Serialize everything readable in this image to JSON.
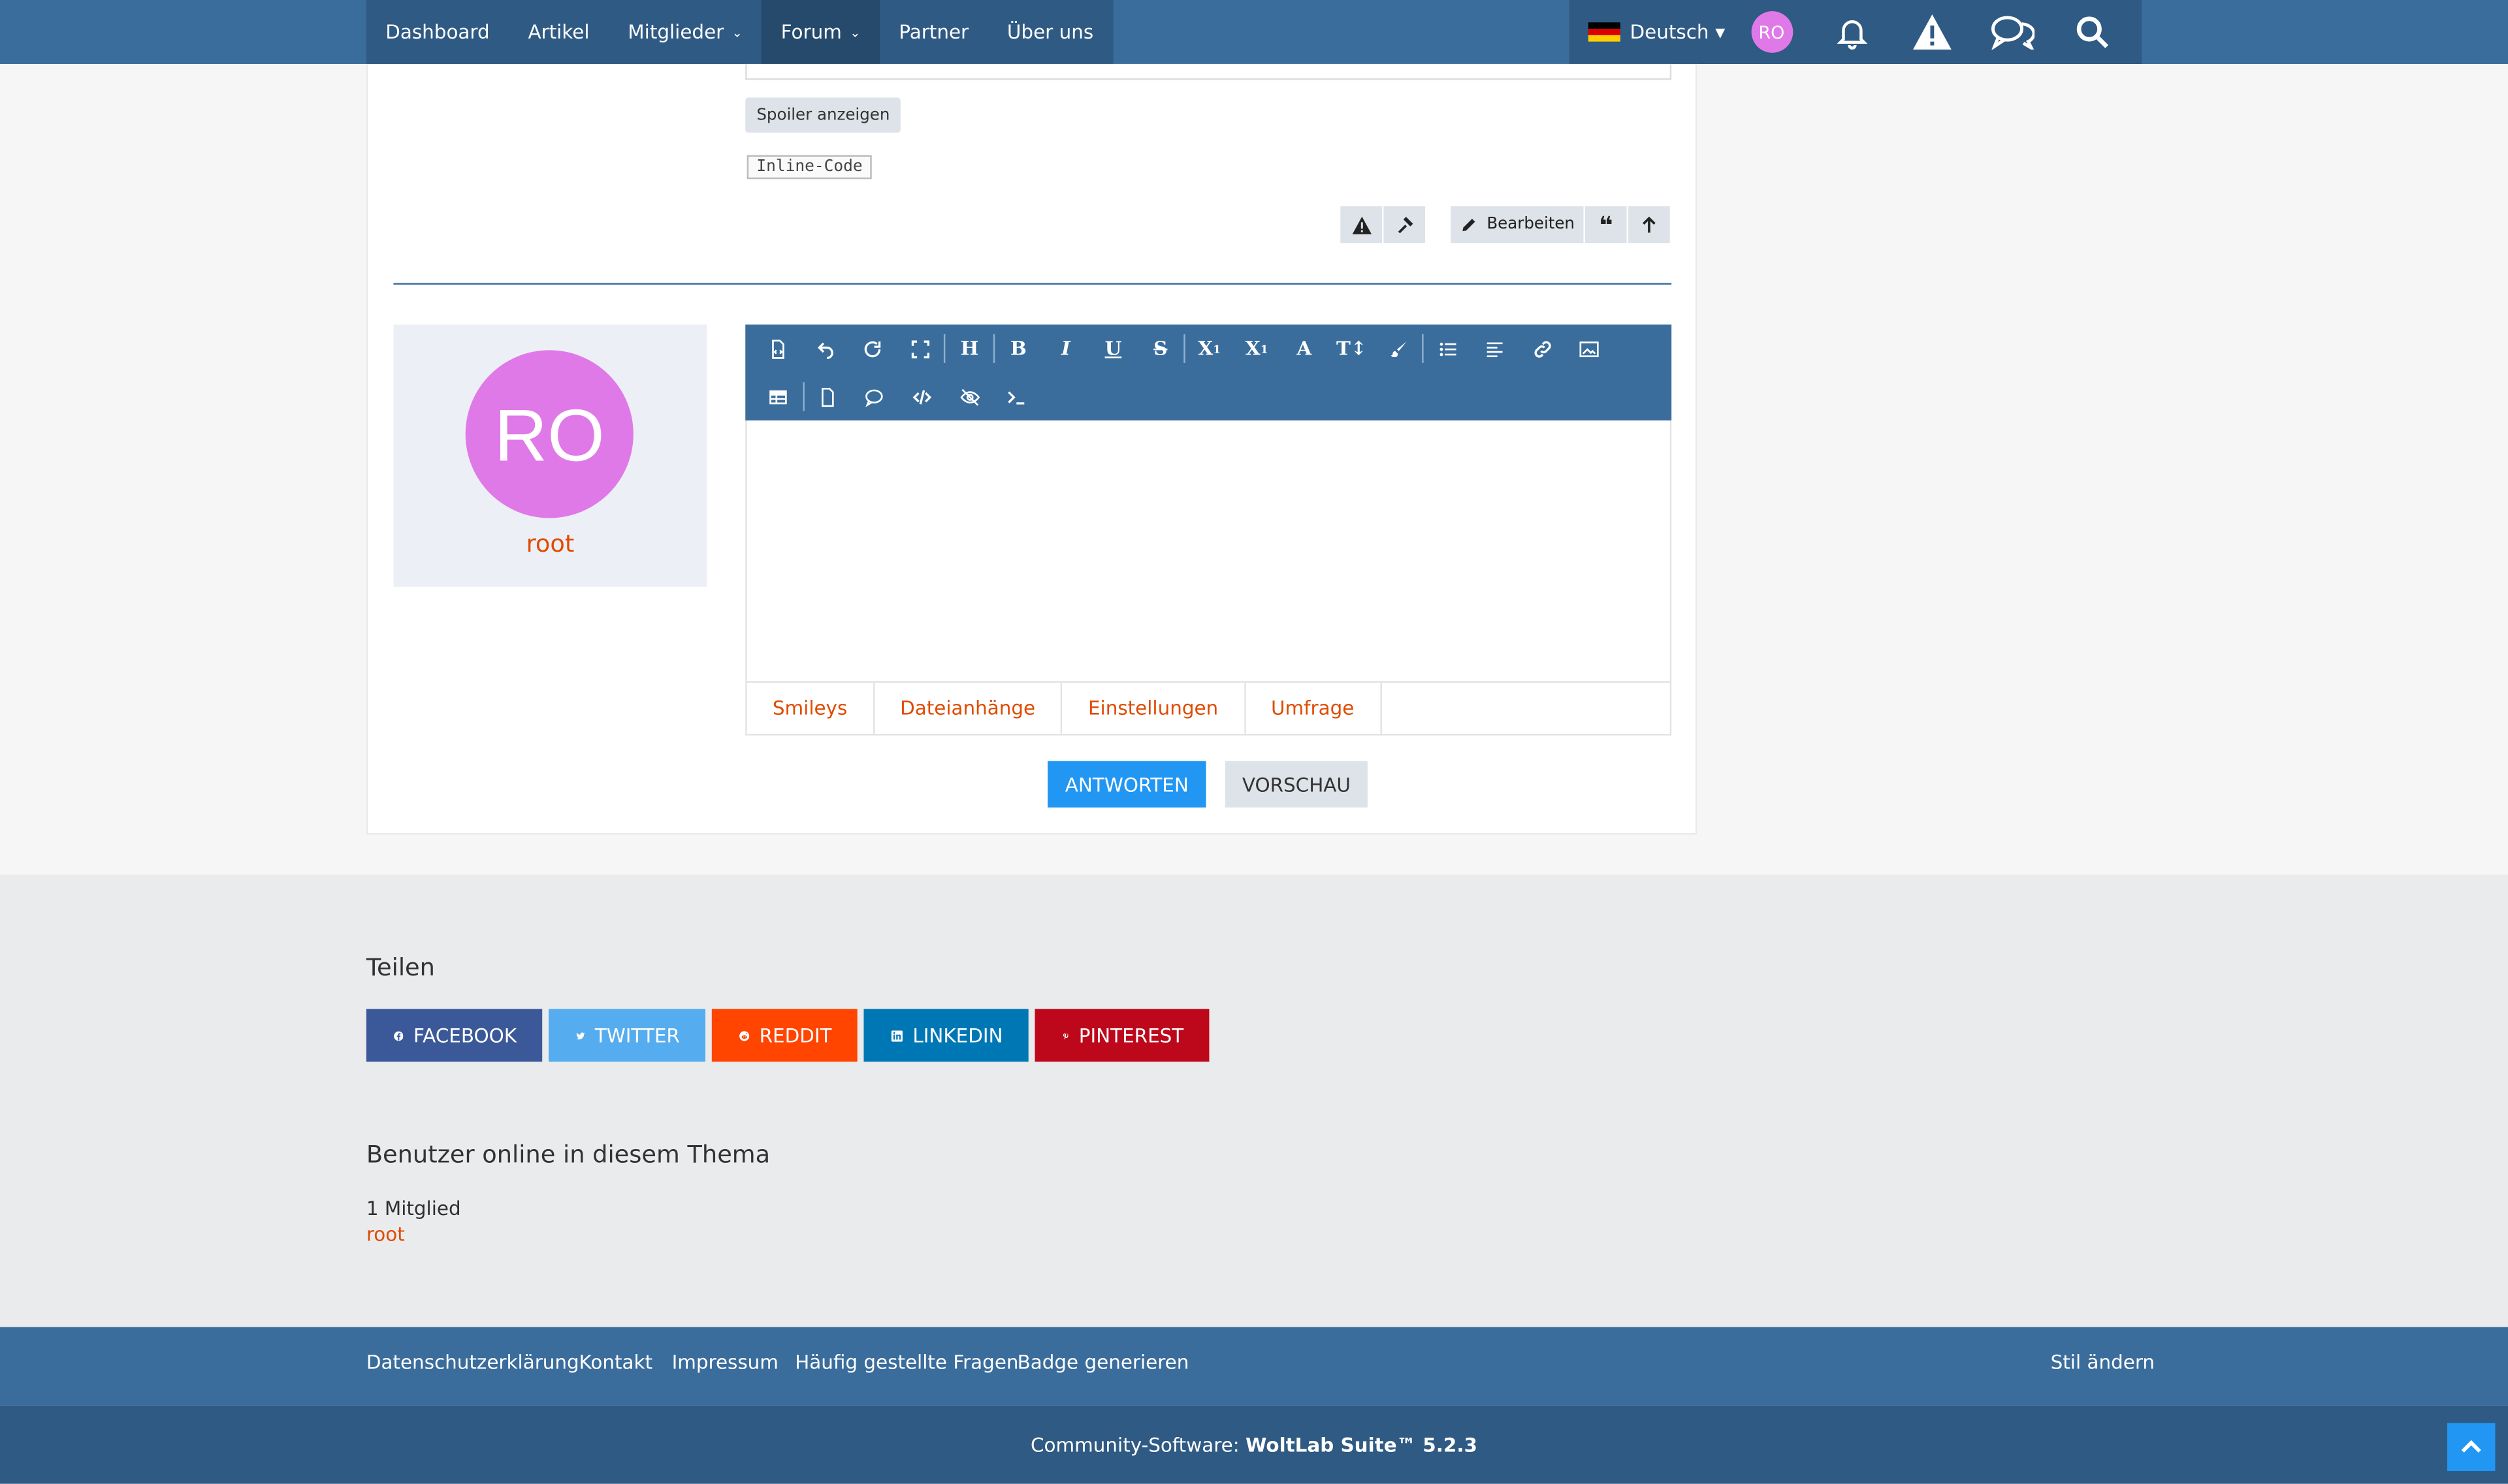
{
  "nav": {
    "items": [
      {
        "label": "Dashboard",
        "active": false,
        "dropdown": false
      },
      {
        "label": "Artikel",
        "active": false,
        "dropdown": false
      },
      {
        "label": "Mitglieder",
        "active": false,
        "dropdown": true
      },
      {
        "label": "Forum",
        "active": true,
        "dropdown": true
      },
      {
        "label": "Partner",
        "active": false,
        "dropdown": false
      },
      {
        "label": "Über uns",
        "active": false,
        "dropdown": false
      }
    ],
    "language": "Deutsch",
    "user_initials": "RO",
    "icons": [
      "bell-icon",
      "warning-icon",
      "conversations-icon",
      "search-icon"
    ]
  },
  "post": {
    "spoiler_button": "Spoiler anzeigen",
    "inline_code": "Inline-Code",
    "edit_button": "Bearbeiten"
  },
  "reply": {
    "avatar_initials": "RO",
    "username": "root",
    "toolbar_row1": [
      "source-code-icon",
      "undo-icon",
      "redo-icon",
      "fullscreen-icon",
      "|",
      "heading-icon",
      "|",
      "bold-icon",
      "italic-icon",
      "underline-icon",
      "strikethrough-icon",
      "|",
      "subscript-icon",
      "superscript-icon",
      "font-family-icon",
      "font-size-icon",
      "color-brush-icon",
      "|",
      "bullet-list-icon",
      "align-left-icon",
      "link-icon",
      "image-icon"
    ],
    "toolbar_row2": [
      "table-icon",
      "|",
      "page-icon",
      "quote-icon",
      "code-icon",
      "spoiler-icon",
      "inline-code-icon"
    ],
    "tabs": [
      "Smileys",
      "Dateianhänge",
      "Einstellungen",
      "Umfrage"
    ],
    "submit_button": "ANTWORTEN",
    "preview_button": "VORSCHAU"
  },
  "share": {
    "title": "Teilen",
    "buttons": [
      {
        "label": "FACEBOOK",
        "color": "#3b5998"
      },
      {
        "label": "TWITTER",
        "color": "#55acee"
      },
      {
        "label": "REDDIT",
        "color": "#ff4500"
      },
      {
        "label": "LINKEDIN",
        "color": "#0077b5"
      },
      {
        "label": "PINTEREST",
        "color": "#bd081c"
      }
    ]
  },
  "online": {
    "title": "Benutzer online in diesem Thema",
    "count": "1 Mitglied",
    "user": "root"
  },
  "footer": {
    "links": [
      "Datenschutzerklärung",
      "Kontakt",
      "Impressum",
      "Häufig gestellte Fragen",
      "Badge generieren"
    ],
    "style_link": "Stil ändern",
    "copyright_prefix": "Community-Software: ",
    "copyright_product": "WoltLab Suite™ 5.2.3"
  },
  "colors": {
    "header": "#3a6d9c",
    "accent_link": "#e04b00",
    "primary_button": "#2196f3",
    "avatar": "#e079e8"
  }
}
